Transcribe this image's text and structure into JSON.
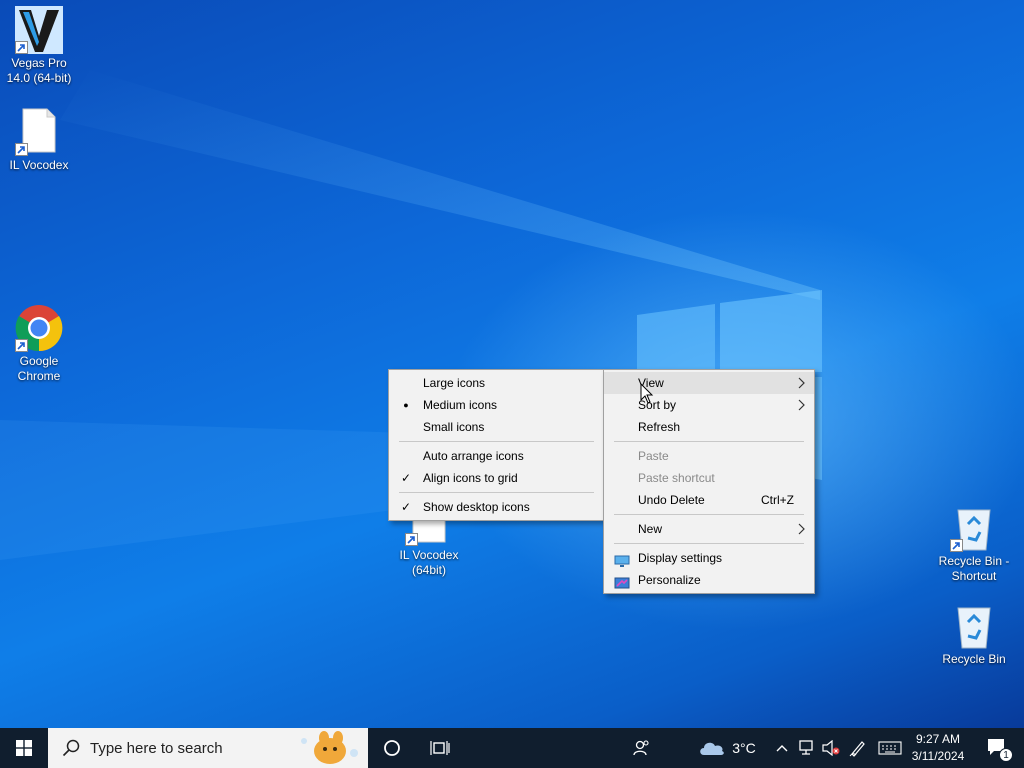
{
  "desktop": {
    "icons": [
      {
        "label": "Vegas Pro 14.0 (64-bit)",
        "icon": "vegas-pro-icon"
      },
      {
        "label": "IL Vocodex",
        "icon": "file-icon"
      },
      {
        "label": "Google Chrome",
        "icon": "chrome-icon"
      },
      {
        "label": "IL Vocodex (64bit)",
        "icon": "file-icon"
      },
      {
        "label": "Recycle Bin - Shortcut",
        "icon": "recycle-bin-icon"
      },
      {
        "label": "Recycle Bin",
        "icon": "recycle-bin-icon"
      }
    ]
  },
  "view_submenu": {
    "items": [
      {
        "label": "Large icons",
        "mark": ""
      },
      {
        "label": "Medium icons",
        "mark": "●"
      },
      {
        "label": "Small icons",
        "mark": ""
      },
      {
        "label": "Auto arrange icons",
        "mark": ""
      },
      {
        "label": "Align icons to grid",
        "mark": "✓"
      },
      {
        "label": "Show desktop icons",
        "mark": "✓"
      }
    ]
  },
  "context_menu": {
    "view": "View",
    "sort_by": "Sort by",
    "refresh": "Refresh",
    "paste": "Paste",
    "paste_shortcut": "Paste shortcut",
    "undo_delete": "Undo Delete",
    "undo_shortcut": "Ctrl+Z",
    "new": "New",
    "display_settings": "Display settings",
    "personalize": "Personalize",
    "submenu_arrow": ">"
  },
  "taskbar": {
    "search_placeholder": "Type here to search",
    "weather_temp": "3°C",
    "time": "9:27 AM",
    "date": "3/11/2024",
    "notification_count": "1"
  },
  "colors": {
    "taskbar_bg": "#101e2e",
    "menu_bg": "#f2f2f2",
    "menu_highlight": "#e1e1e1",
    "desktop_accent": "#0f7ee8"
  }
}
